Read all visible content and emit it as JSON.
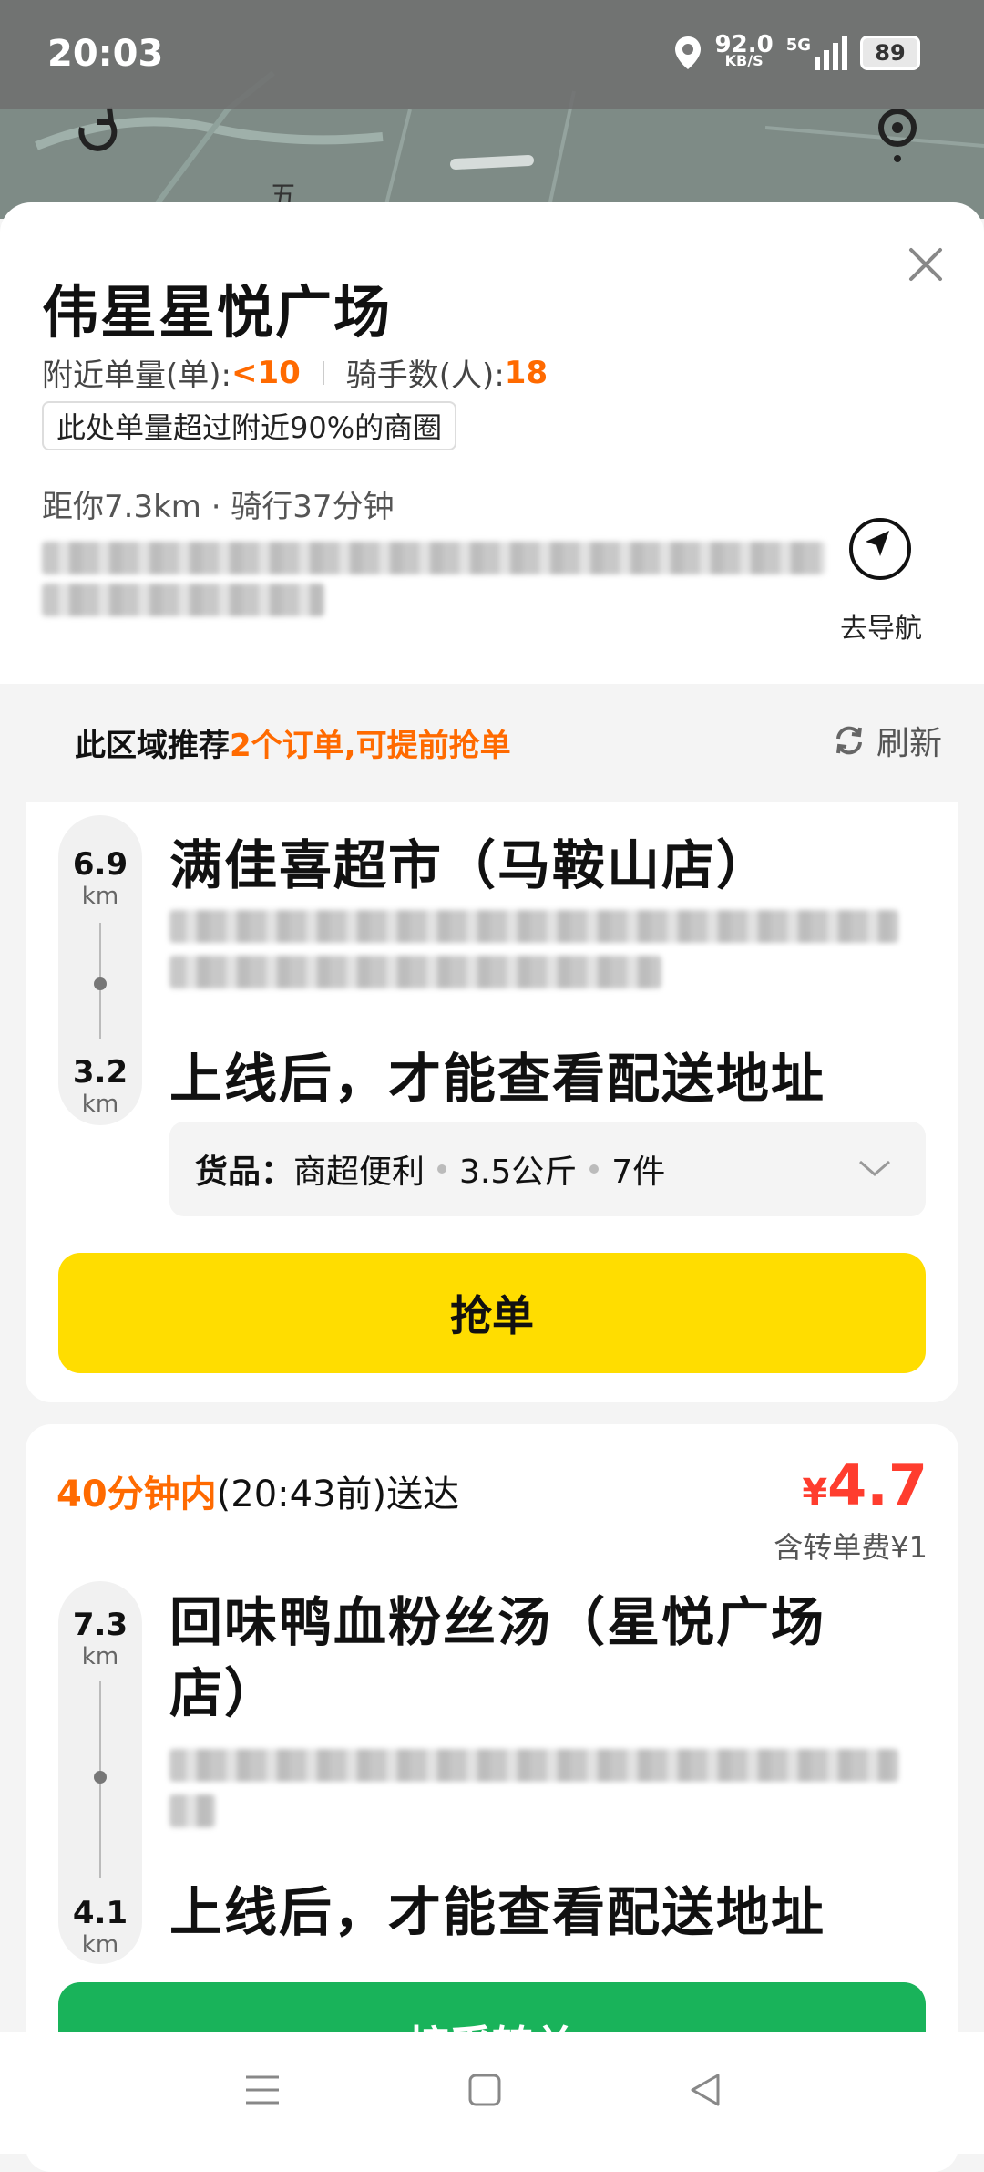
{
  "status_bar": {
    "time": "20:03",
    "net_speed_value": "92.0",
    "net_speed_unit": "KB/S",
    "network_type": "5G",
    "battery": "89"
  },
  "map": {
    "label": "五"
  },
  "sheet": {
    "title": "伟星星悦广场",
    "nearby_orders_label": "附近单量(单):",
    "nearby_orders_value": "<10",
    "riders_label": "骑手数(人):",
    "riders_value": "18",
    "badge": "此处单量超过附近90%的商圈",
    "distance": "距你7.3km · 骑行37分钟",
    "navigate_label": "去导航"
  },
  "recommend": {
    "prefix": "此区域推荐",
    "highlight": "2个订单,可提前抢单",
    "refresh_label": "刷新"
  },
  "orders": [
    {
      "pickup_km": "6.9",
      "dropoff_km": "3.2",
      "km_unit": "km",
      "store": "满佳喜超市（马鞍山店）",
      "delivery_note": "上线后，才能查看配送地址",
      "goods_label": "货品：",
      "goods_category": "商超便利",
      "goods_weight": "3.5公斤",
      "goods_count": "7件",
      "button": "抢单"
    },
    {
      "deliver_within": "40分钟内",
      "deliver_before": "(20:43前)送达",
      "price_symbol": "¥",
      "price": "4.7",
      "fee_note": "含转单费¥1",
      "pickup_km": "7.3",
      "dropoff_km": "4.1",
      "km_unit": "km",
      "store": "回味鸭血粉丝汤（星悦广场店）",
      "delivery_note": "上线后，才能查看配送地址",
      "button": "接受转单"
    }
  ],
  "colors": {
    "accent_orange": "#ff6a00",
    "grab_yellow": "#ffdd00",
    "accept_green": "#19b35a",
    "price_red": "#ff3d2e"
  }
}
